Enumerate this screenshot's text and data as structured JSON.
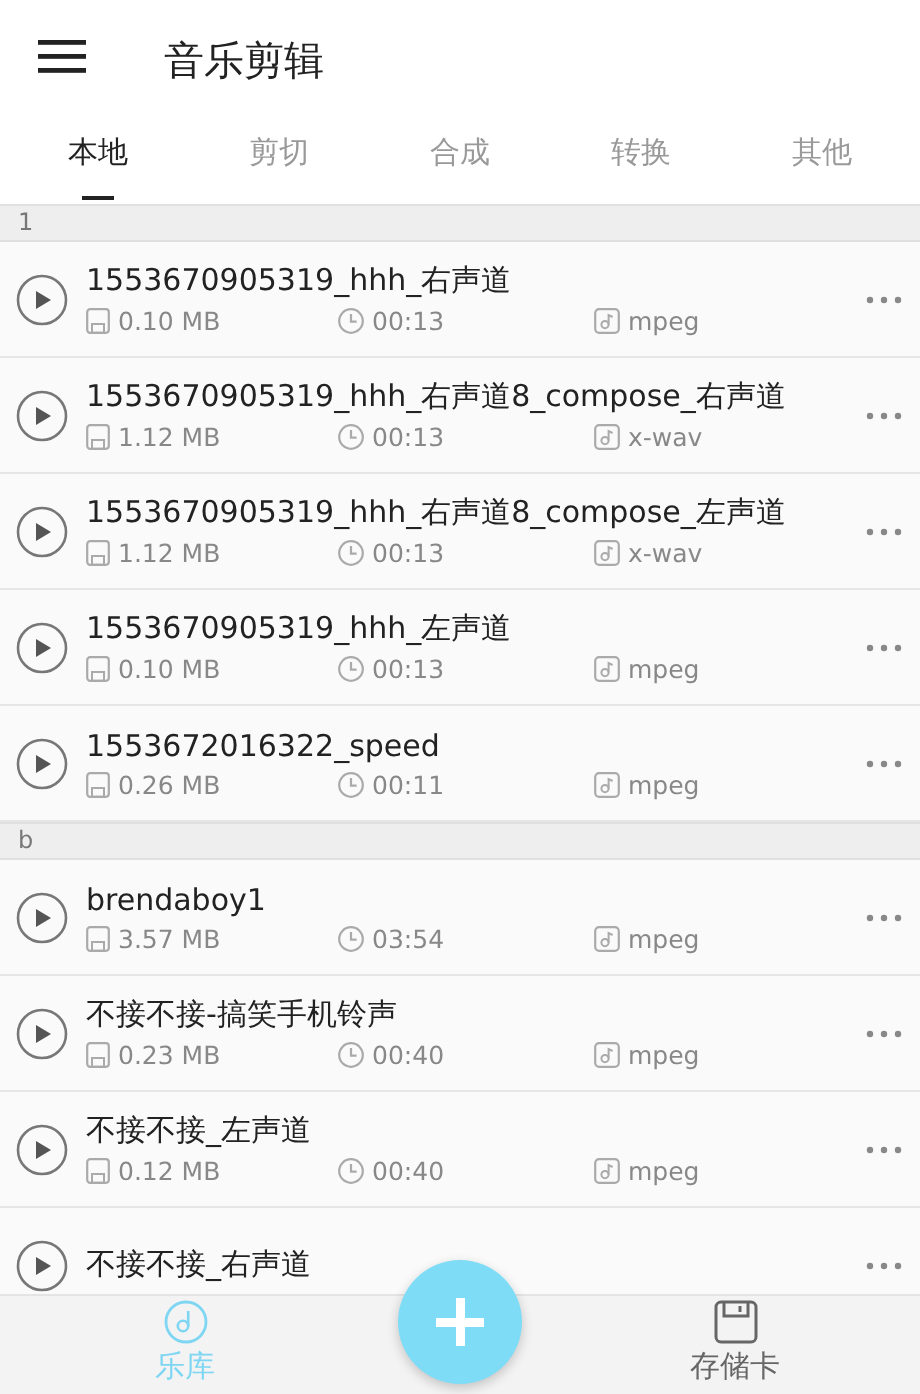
{
  "header": {
    "title": "音乐剪辑"
  },
  "tabs": [
    {
      "label": "本地",
      "selected": true
    },
    {
      "label": "剪切",
      "selected": false
    },
    {
      "label": "合成",
      "selected": false
    },
    {
      "label": "转换",
      "selected": false
    },
    {
      "label": "其他",
      "selected": false
    }
  ],
  "groups": [
    {
      "letter": "1",
      "files": [
        {
          "name": "1553670905319_hhh_右声道",
          "size": "0.10 MB",
          "duration": "00:13",
          "format": "mpeg"
        },
        {
          "name": "1553670905319_hhh_右声道8_compose_右声道",
          "size": "1.12 MB",
          "duration": "00:13",
          "format": "x-wav"
        },
        {
          "name": "1553670905319_hhh_右声道8_compose_左声道",
          "size": "1.12 MB",
          "duration": "00:13",
          "format": "x-wav"
        },
        {
          "name": "1553670905319_hhh_左声道",
          "size": "0.10 MB",
          "duration": "00:13",
          "format": "mpeg"
        },
        {
          "name": "1553672016322_speed",
          "size": "0.26 MB",
          "duration": "00:11",
          "format": "mpeg"
        }
      ]
    },
    {
      "letter": "b",
      "files": [
        {
          "name": "brendaboy1",
          "size": "3.57 MB",
          "duration": "03:54",
          "format": "mpeg"
        },
        {
          "name": "不接不接-搞笑手机铃声",
          "size": "0.23 MB",
          "duration": "00:40",
          "format": "mpeg"
        },
        {
          "name": "不接不接_左声道",
          "size": "0.12 MB",
          "duration": "00:40",
          "format": "mpeg"
        },
        {
          "name": "不接不接_右声道"
        }
      ]
    }
  ],
  "bottom_nav": [
    {
      "kind": "library",
      "label": "乐库",
      "selected": true
    },
    {
      "kind": "add"
    },
    {
      "kind": "card",
      "label": "存储卡",
      "selected": false
    }
  ]
}
